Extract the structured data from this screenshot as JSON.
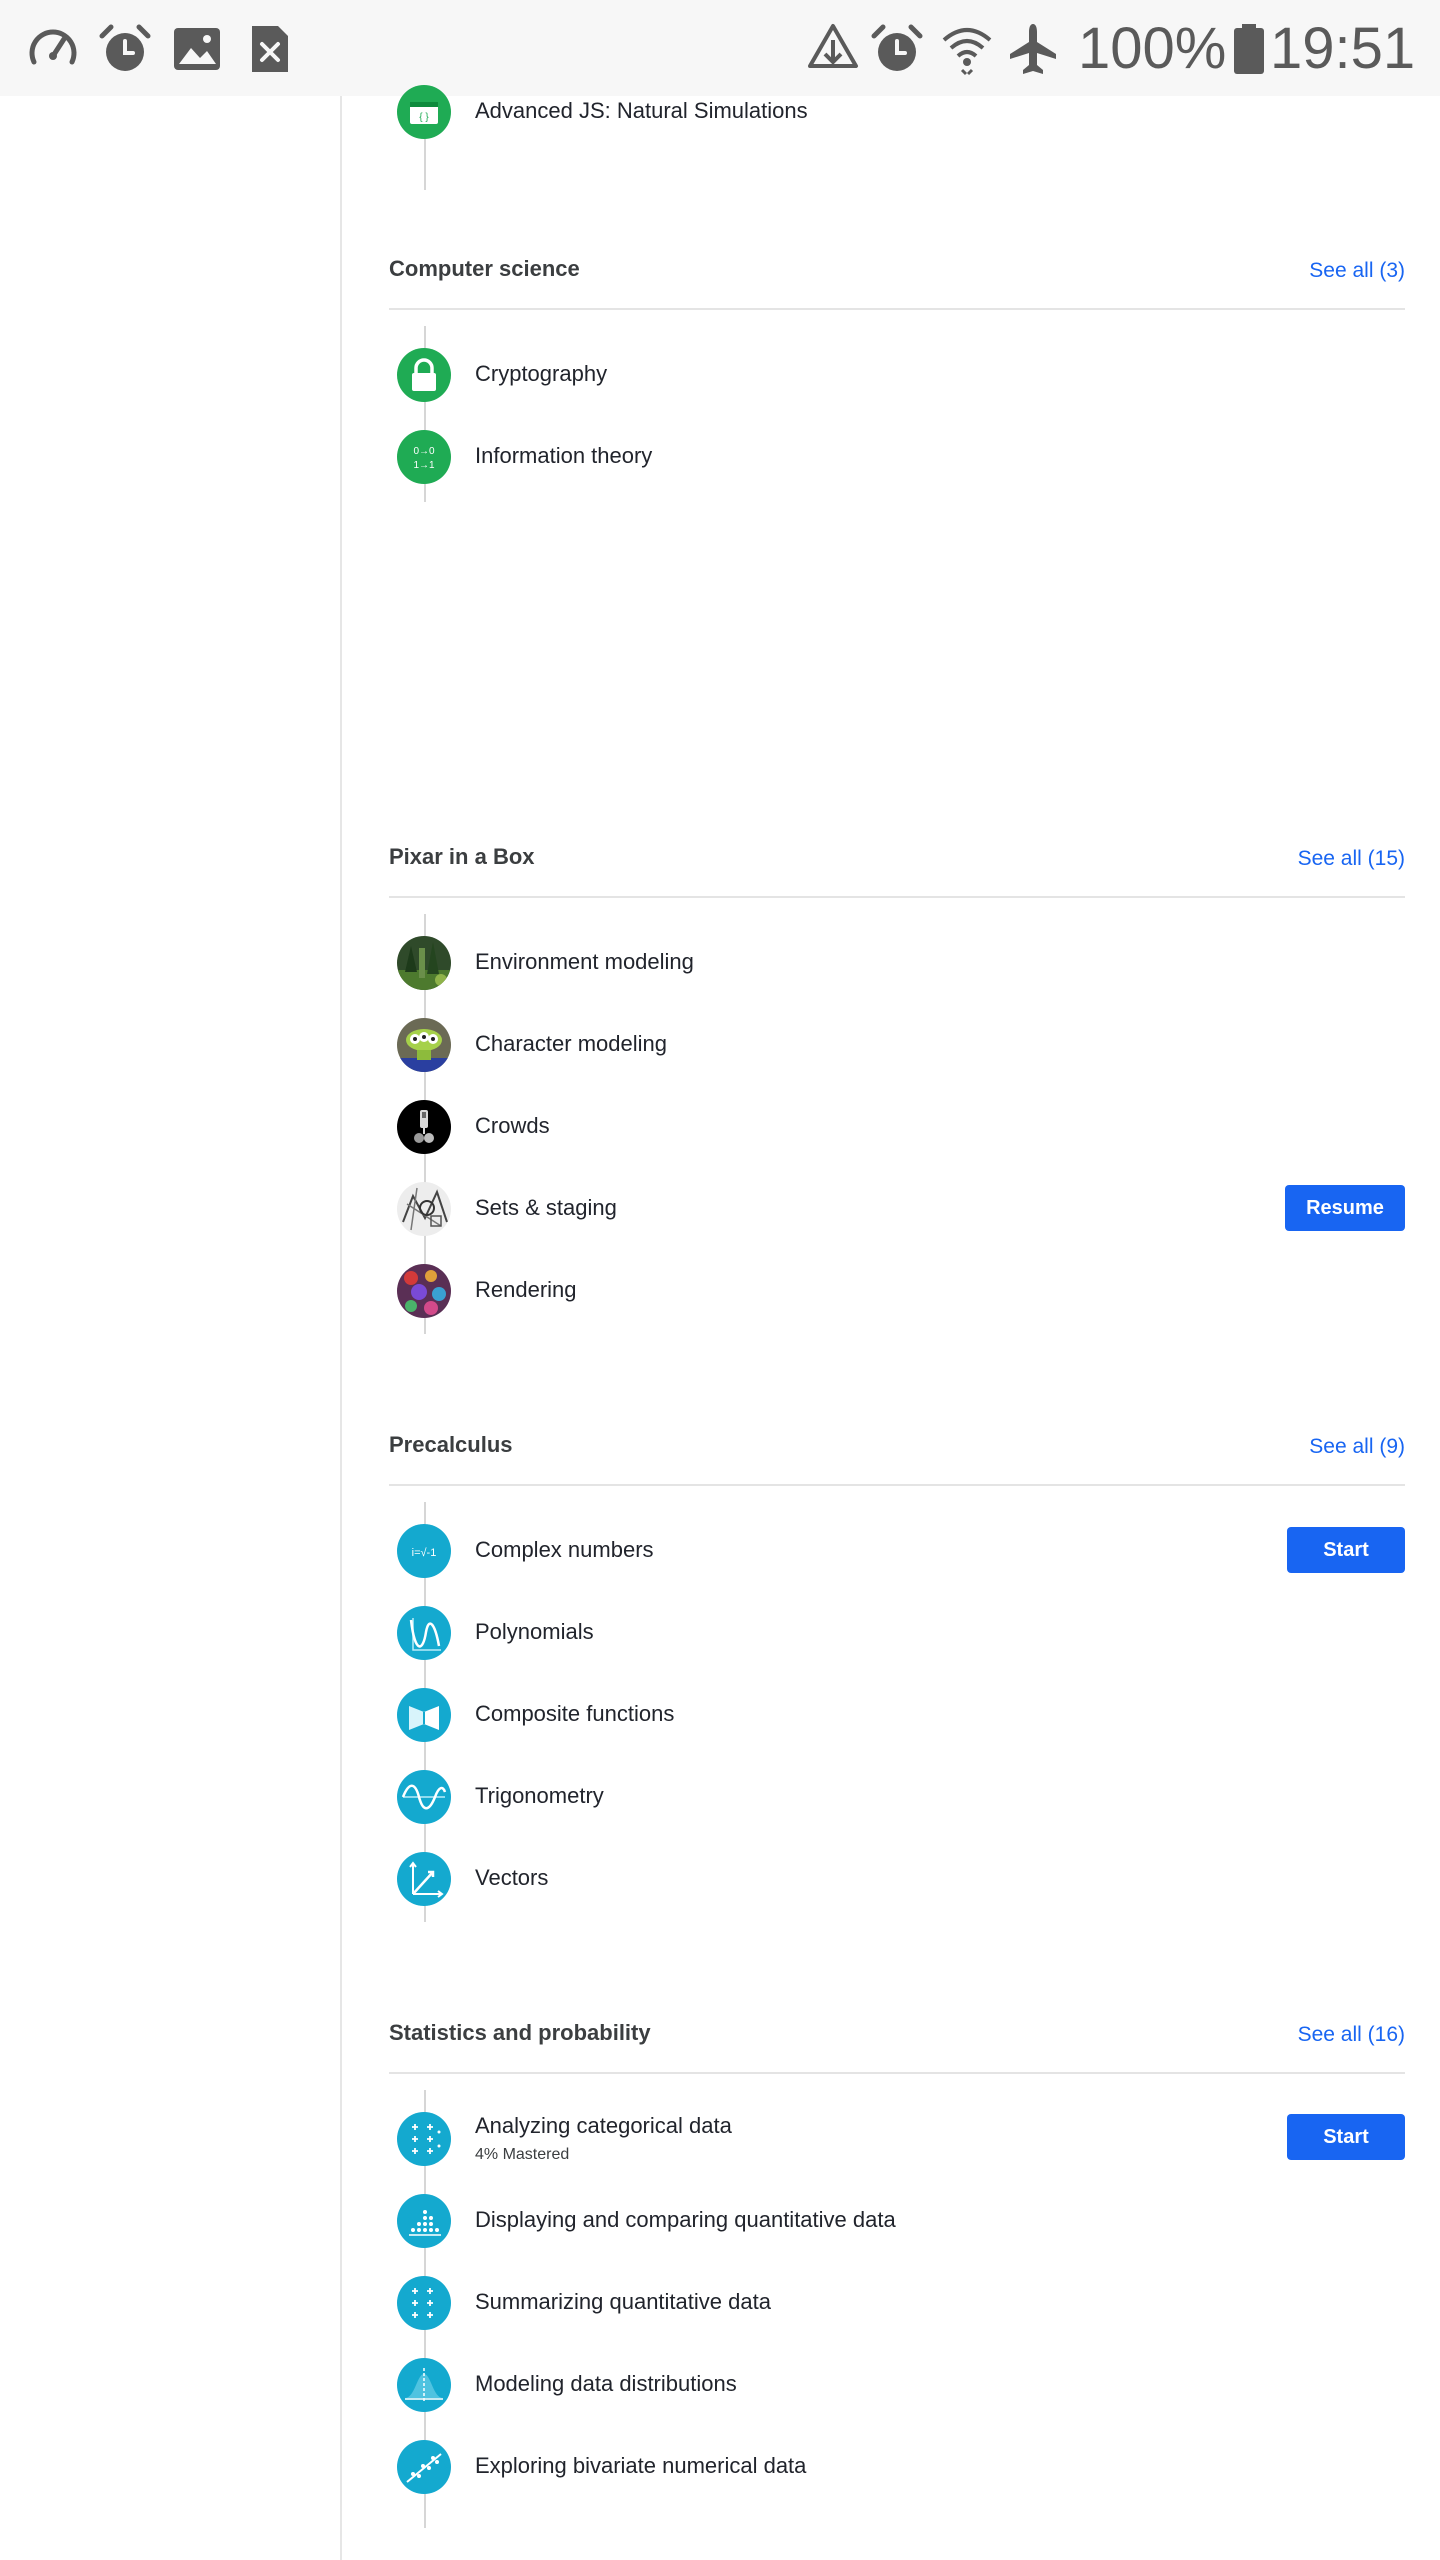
{
  "status_bar": {
    "battery": "100%",
    "time": "19:51",
    "icons": [
      "speedometer-icon",
      "alarm-clock-icon",
      "image-icon",
      "sim-error-icon",
      "data-saver-icon",
      "alarm-clock-icon",
      "wifi-icon",
      "airplane-mode-icon",
      "battery-icon"
    ]
  },
  "sections": {
    "advanced_js": {
      "items": [
        {
          "label": "Advanced JS: Natural Simulations",
          "icon": "code-window-icon"
        }
      ]
    },
    "computer_science": {
      "title": "Computer science",
      "see_all": "See all (3)",
      "items": [
        {
          "label": "Cryptography",
          "icon": "padlock-icon"
        },
        {
          "label": "Information theory",
          "icon": "binary-arrows-icon",
          "icon_text_top": "0→0",
          "icon_text_bottom": "1→1"
        }
      ]
    },
    "pixar": {
      "title": "Pixar in a Box",
      "see_all": "See all (15)",
      "items": [
        {
          "label": "Environment modeling",
          "icon": "forest-scene-icon"
        },
        {
          "label": "Character modeling",
          "icon": "alien-character-icon"
        },
        {
          "label": "Crowds",
          "icon": "crowd-robot-icon"
        },
        {
          "label": "Sets & staging",
          "icon": "sketch-scene-icon",
          "button": "Resume"
        },
        {
          "label": "Rendering",
          "icon": "colorful-render-icon"
        }
      ]
    },
    "precalculus": {
      "title": "Precalculus",
      "see_all": "See all (9)",
      "items": [
        {
          "label": "Complex numbers",
          "icon": "imaginary-unit-icon",
          "icon_text": "i=√-1",
          "button": "Start"
        },
        {
          "label": "Polynomials",
          "icon": "polynomial-curve-icon"
        },
        {
          "label": "Composite functions",
          "icon": "composite-shapes-icon"
        },
        {
          "label": "Trigonometry",
          "icon": "sine-wave-icon"
        },
        {
          "label": "Vectors",
          "icon": "vector-axes-icon"
        }
      ]
    },
    "statistics": {
      "title": "Statistics and probability",
      "see_all": "See all (16)",
      "items": [
        {
          "label": "Analyzing categorical data",
          "sub": "4% Mastered",
          "icon": "plus-grid-icon",
          "button": "Start"
        },
        {
          "label": "Displaying and comparing quantitative data",
          "icon": "dot-plot-icon"
        },
        {
          "label": "Summarizing quantitative data",
          "icon": "plus-grid-icon"
        },
        {
          "label": "Modeling data distributions",
          "icon": "bell-curve-icon"
        },
        {
          "label": "Exploring bivariate numerical data",
          "icon": "scatter-trend-icon"
        }
      ]
    }
  },
  "colors": {
    "accent_blue": "#1865f2",
    "cs_green": "#1fab54",
    "math_teal": "#14a9cf",
    "title_gray": "#3b3e40",
    "text_dark": "#21242c"
  }
}
